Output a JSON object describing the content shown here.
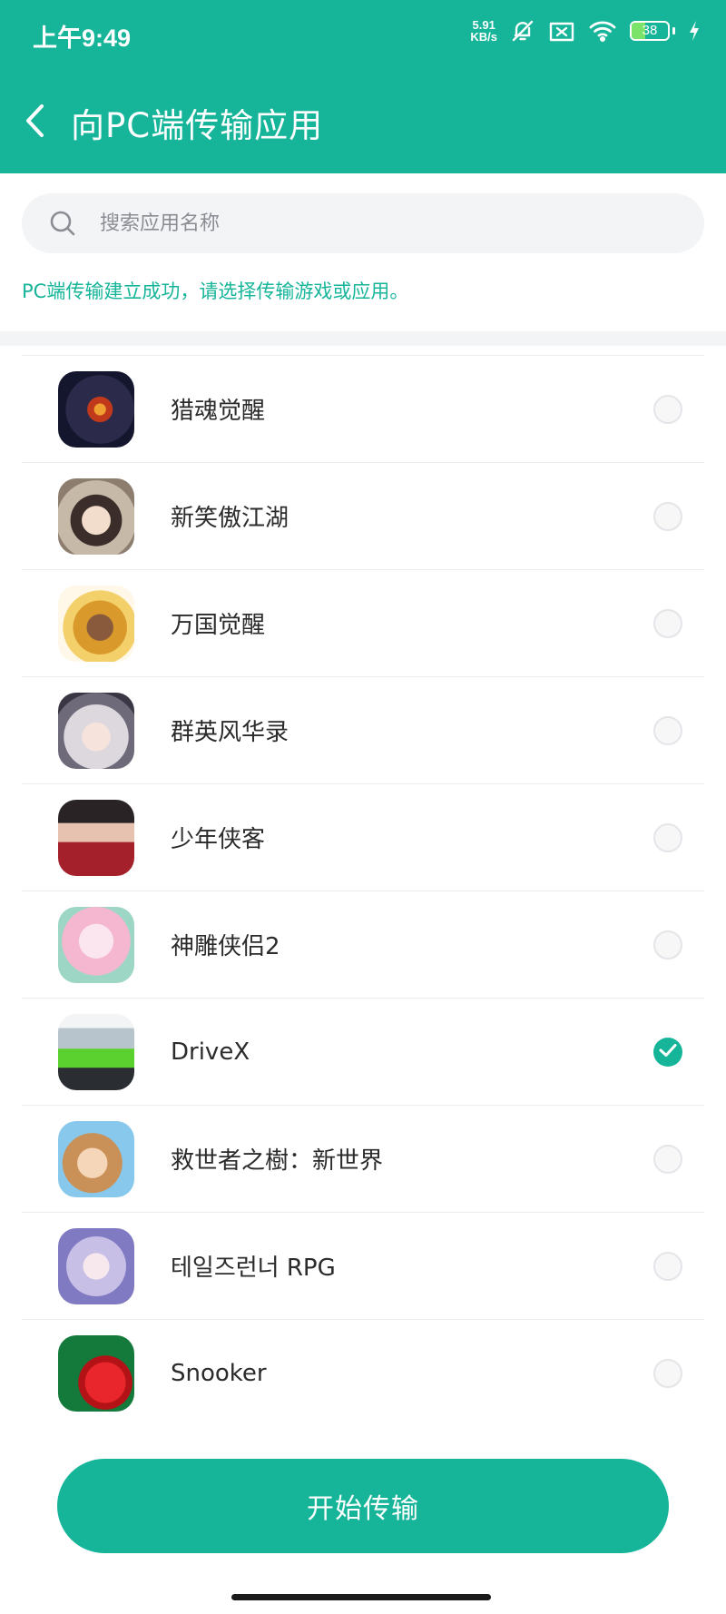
{
  "status_bar": {
    "time": "上午9:49",
    "net_speed_value": "5.91",
    "net_speed_unit": "KB/s",
    "battery_level": "38",
    "battery_fraction": 0.38
  },
  "header": {
    "title": "向PC端传输应用",
    "back_icon": "chevron-left-icon",
    "bg_color": "#16b59a"
  },
  "search": {
    "placeholder": "搜索应用名称",
    "value": ""
  },
  "hint": "PC端传输建立成功，请选择传输游戏或应用。",
  "apps": [
    {
      "name": "猎魂觉醒",
      "checked": false
    },
    {
      "name": "新笑傲江湖",
      "checked": false
    },
    {
      "name": "万国觉醒",
      "checked": false
    },
    {
      "name": "群英风华录",
      "checked": false
    },
    {
      "name": "少年侠客",
      "checked": false
    },
    {
      "name": "神雕侠侣2",
      "checked": false
    },
    {
      "name": "DriveX",
      "checked": true
    },
    {
      "name": "救世者之樹：新世界",
      "checked": false
    },
    {
      "name": "테일즈런너 RPG",
      "checked": false
    },
    {
      "name": "Snooker",
      "checked": false
    }
  ],
  "start_button": "开始传输",
  "colors": {
    "accent": "#16b59a",
    "hint_text": "#16b59a"
  }
}
